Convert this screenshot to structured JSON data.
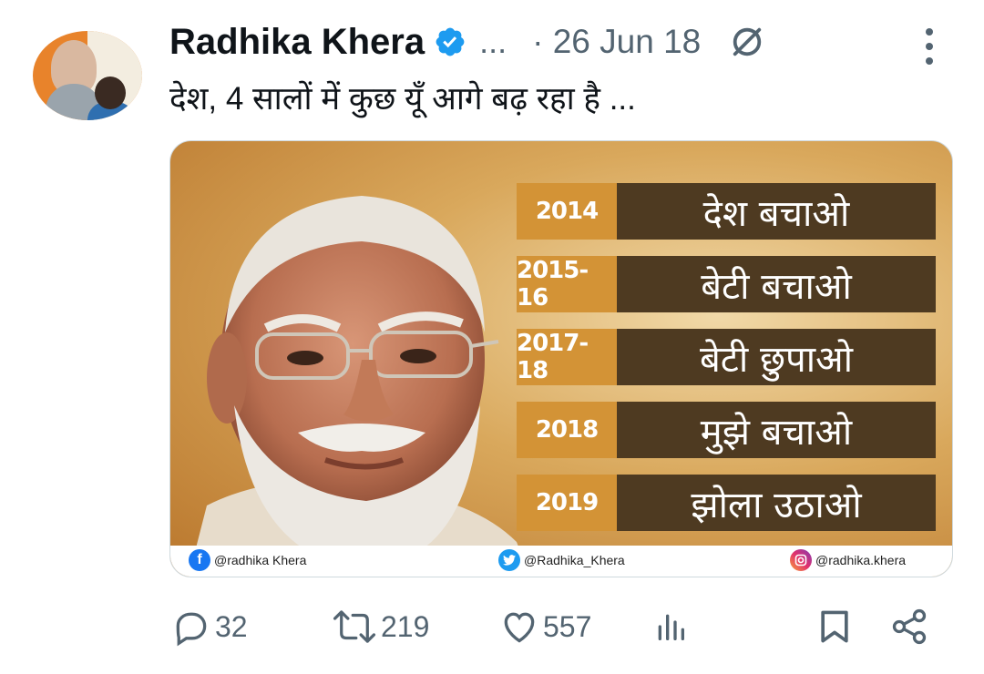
{
  "tweet": {
    "author_name": "Radhika Khera",
    "ellipsis": "...",
    "date": "· 26 Jun 18",
    "text": "देश, 4 सालों में कुछ यूँ आगे बढ़ रहा है ..."
  },
  "media": {
    "rows": [
      {
        "year": "2014",
        "slogan": "देश  बचाओ"
      },
      {
        "year": "2015-16",
        "slogan": "बेटी  बचाओ"
      },
      {
        "year": "2017-18",
        "slogan": "बेटी  छुपाओ"
      },
      {
        "year": "2018",
        "slogan": "मुझे  बचाओ"
      },
      {
        "year": "2019",
        "slogan": "झोला  उठाओ"
      }
    ],
    "social": {
      "facebook": "@radhika Khera",
      "twitter": "@Radhika_Khera",
      "instagram": "@radhika.khera"
    }
  },
  "actions": {
    "replies": "32",
    "retweets": "219",
    "likes": "557"
  },
  "colors": {
    "verified_blue": "#1d9bf0",
    "muted_text": "#536471",
    "year_box": "#d39336",
    "slogan_box": "#4e3a21"
  },
  "icons": [
    "verified-badge-icon",
    "no-entry-icon",
    "more-vertical-icon",
    "reply-icon",
    "retweet-icon",
    "like-icon",
    "views-icon",
    "bookmark-icon",
    "share-icon",
    "facebook-icon",
    "twitter-icon",
    "instagram-icon"
  ]
}
